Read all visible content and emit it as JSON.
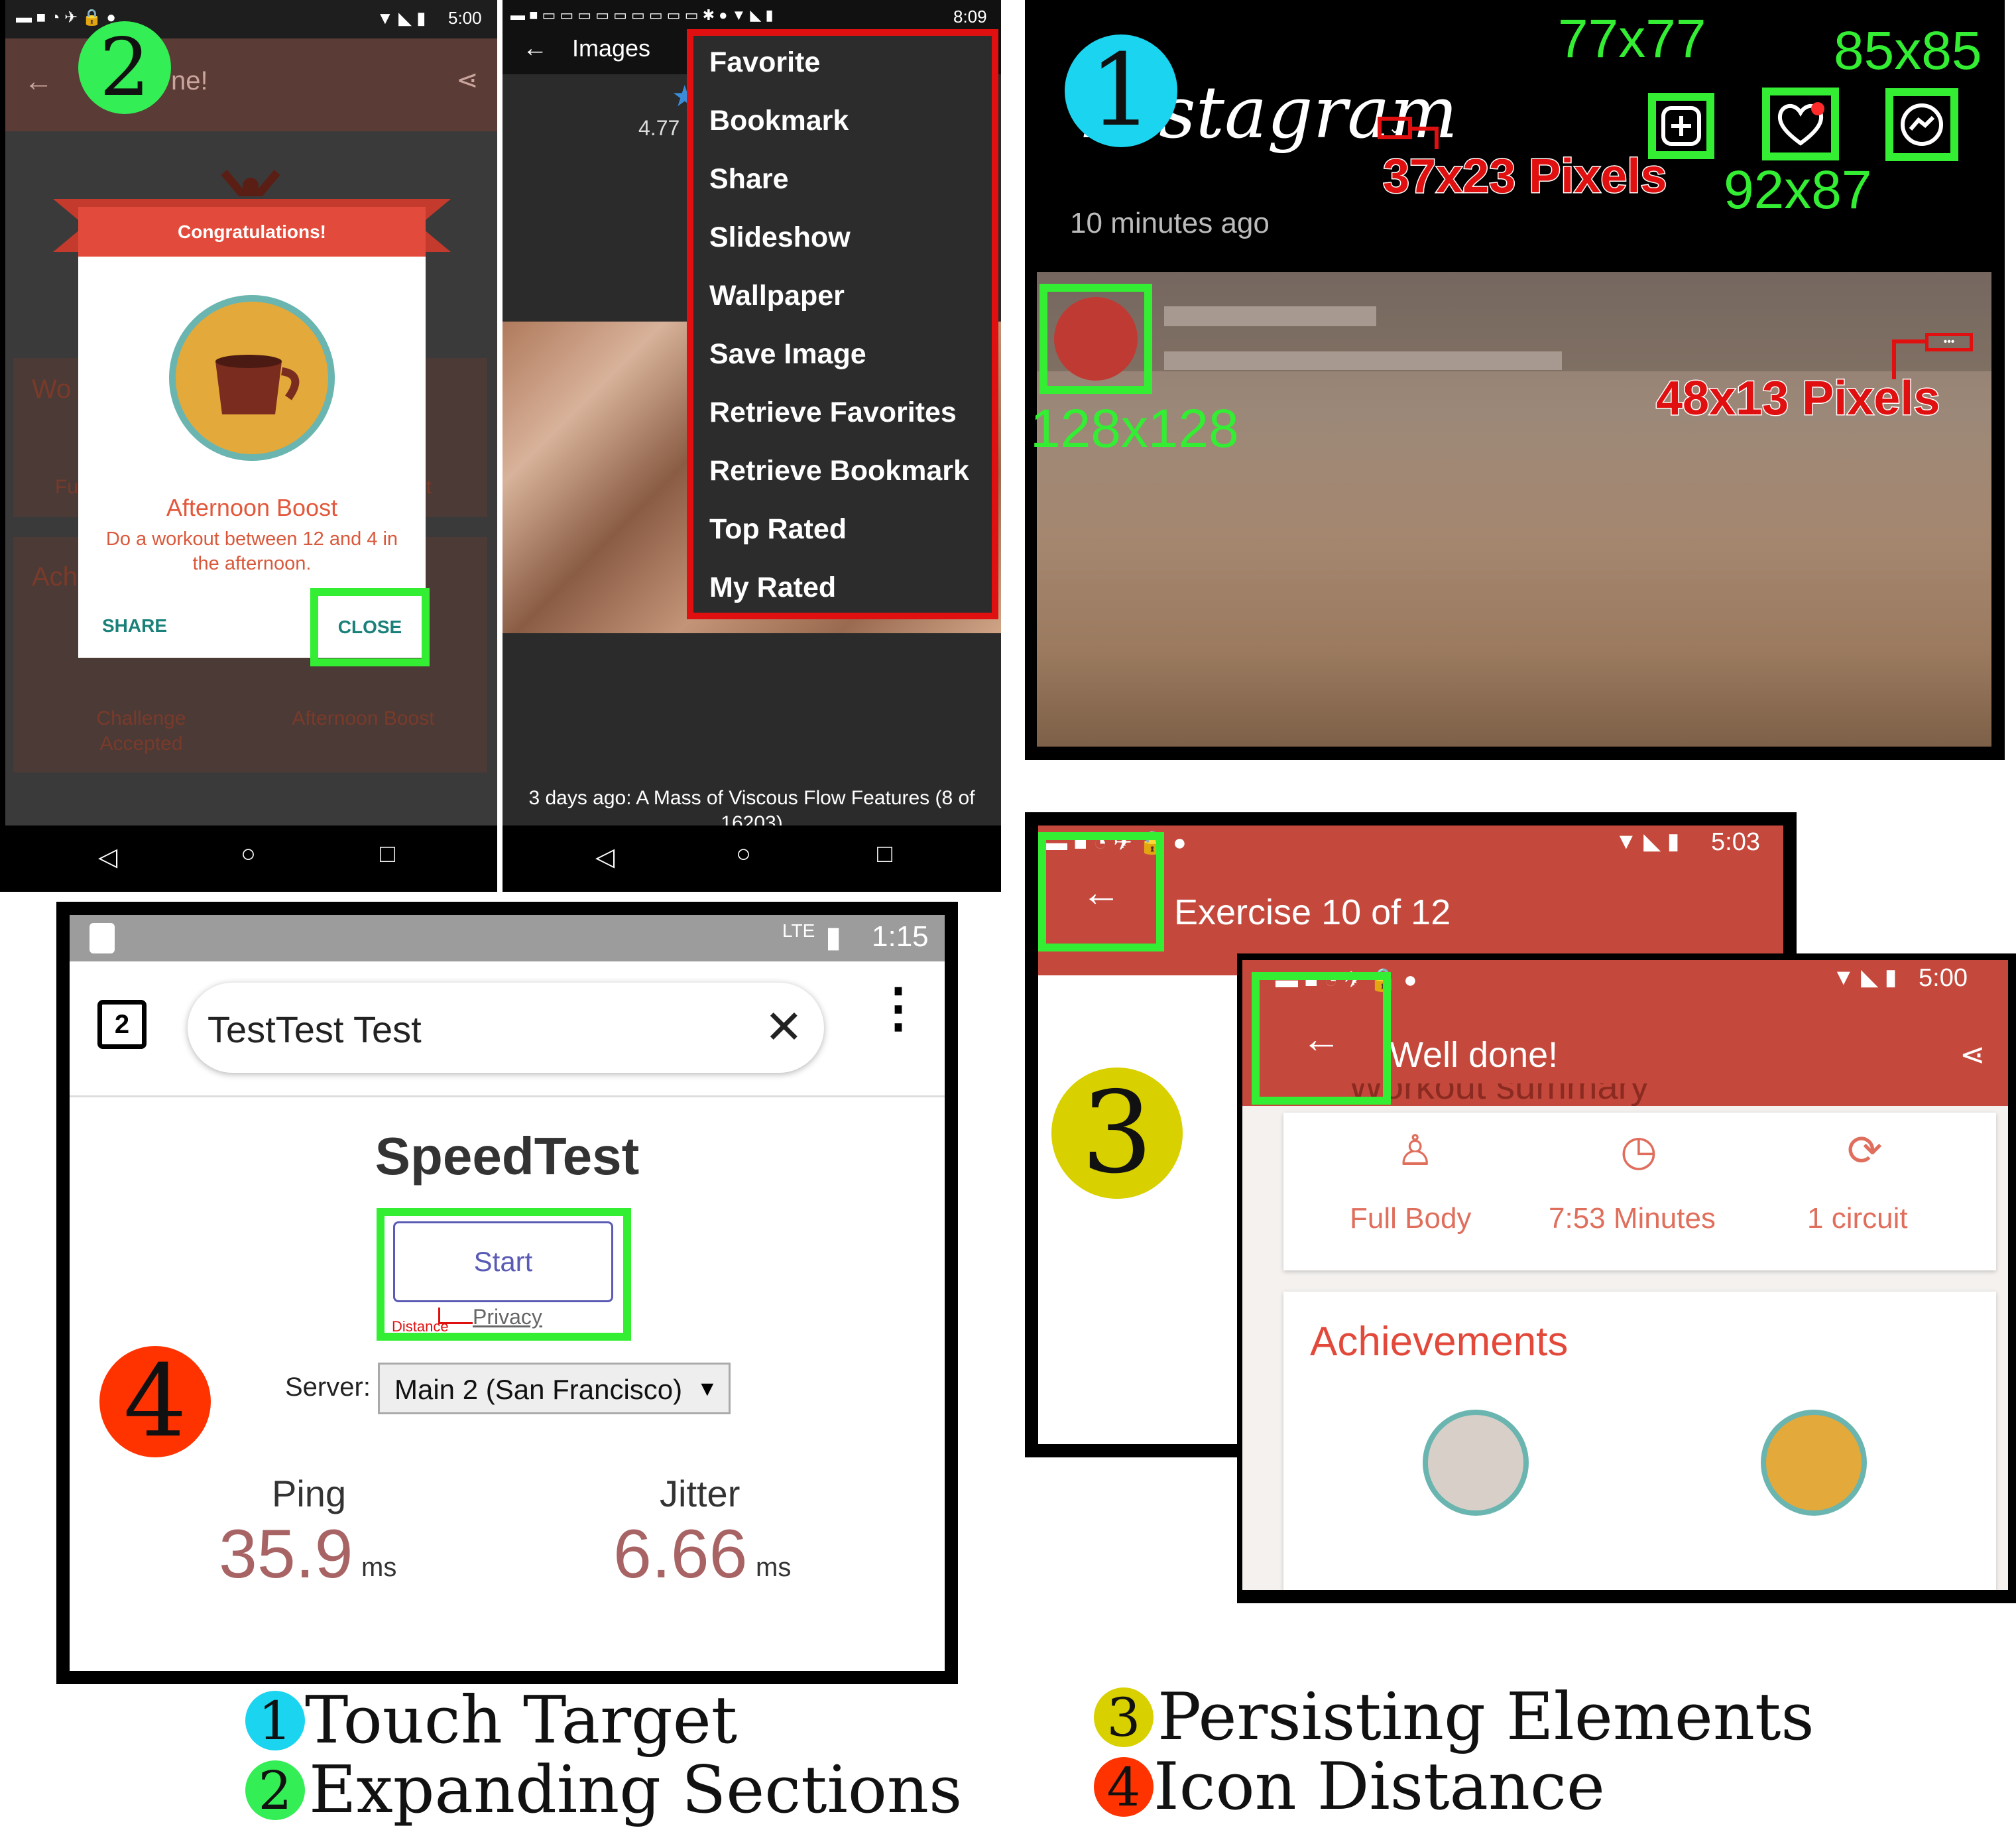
{
  "panel2": {
    "badge": "2",
    "left_screen": {
      "time": "5:00",
      "toolbar_title_partial": "ne!",
      "dialog": {
        "ribbon": "Congratulations!",
        "title": "Afternoon Boost",
        "text": "Do a workout between 12 and 4 in the afternoon.",
        "share": "SHARE",
        "close": "CLOSE"
      },
      "bg_labels": [
        "Wo",
        "Fu",
        "it",
        "Ach",
        "Challenge Accepted",
        "Afternoon Boost"
      ]
    },
    "right_screen": {
      "time": "8:09",
      "toolbar_title": "Images",
      "rating": "4.77",
      "menu": [
        "Favorite",
        "Bookmark",
        "Share",
        "Slideshow",
        "Wallpaper",
        "Save Image",
        "Retrieve Favorites",
        "Retrieve Bookmark",
        "Top Rated",
        "My Rated"
      ],
      "caption": "3 days ago: A Mass of Viscous Flow Features (8 of 16203)"
    },
    "nav": {
      "back": "◁",
      "home": "○",
      "recents": "□"
    }
  },
  "panel1": {
    "badge": "1",
    "logo_text": "Instagram",
    "size_labels": {
      "plus": "77x77",
      "messenger": "85x85",
      "heart": "92x87",
      "dropdown": "37x23 Pixels",
      "avatar": "128x128",
      "more": "48x13 Pixels"
    },
    "time_ago": "10 minutes ago"
  },
  "panel4": {
    "badge": "4",
    "time": "1:15",
    "net": "LTE",
    "tab_count": "2",
    "search_text": "TestTest Test",
    "title": "SpeedTest",
    "start": "Start",
    "privacy": "Privacy",
    "distance": "Distance",
    "server_label": "Server:",
    "server_value": "Main 2 (San Francisco)",
    "ping_label": "Ping",
    "ping_value": "35.9",
    "jitter_label": "Jitter",
    "jitter_value": "6.66",
    "unit": "ms"
  },
  "panel3": {
    "badge": "3",
    "back_time": "5:03",
    "back_title": "Exercise 10 of 12",
    "front_time": "5:00",
    "front_title": "Well done!",
    "partial_heading": "Workout summary",
    "stats": [
      "Full Body",
      "7:53 Minutes",
      "1 circuit"
    ],
    "achievements": "Achievements"
  },
  "legend": [
    {
      "num": "1",
      "label": "Touch Target",
      "color": "#1ad4f0"
    },
    {
      "num": "2",
      "label": "Expanding Sections",
      "color": "#33ee55"
    },
    {
      "num": "3",
      "label": "Persisting Elements",
      "color": "#d9d000"
    },
    {
      "num": "4",
      "label": "Icon Distance",
      "color": "#ff3300"
    }
  ],
  "colors": {
    "touch_target": "#1ad4f0",
    "expanding_sections": "#33ee55",
    "persisting_elements": "#d9d000",
    "icon_distance": "#ff3300",
    "highlight_green": "#33ee33",
    "highlight_red": "#e01010",
    "app_red": "#c4483b"
  }
}
